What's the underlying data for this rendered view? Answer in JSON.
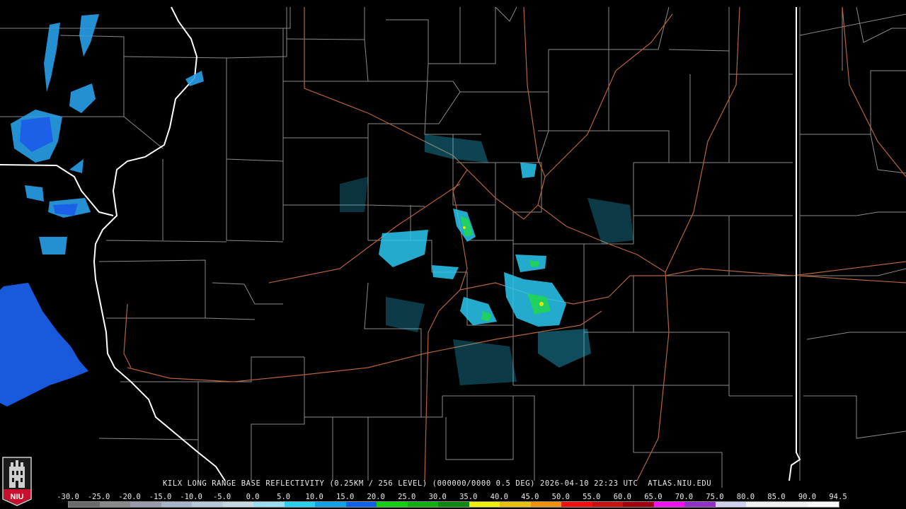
{
  "product": {
    "caption": "KILX LONG RANGE BASE REFLECTIVITY (0.25KM / 256 LEVEL) (000000/0000 0.5 DEG) 2026-04-10 22:23 UTC  ATLAS.NIU.EDU"
  },
  "legend": {
    "values": [
      "-30.0",
      "-25.0",
      "-20.0",
      "-15.0",
      "-10.0",
      "-5.0",
      "0.0",
      "5.0",
      "10.0",
      "15.0",
      "20.0",
      "25.0",
      "30.0",
      "35.0",
      "40.0",
      "45.0",
      "50.0",
      "55.0",
      "60.0",
      "65.0",
      "70.0",
      "75.0",
      "80.0",
      "85.0",
      "90.0",
      "94.5"
    ],
    "colors": [
      "#6a6a6a",
      "#8a8a8a",
      "#9a9aaa",
      "#aab4c8",
      "#b8c8d8",
      "#c8d8e0",
      "#9adcf0",
      "#2ad0f0",
      "#10a0e8",
      "#1060e8",
      "#10d010",
      "#10b010",
      "#108810",
      "#f0f010",
      "#e8c010",
      "#f09010",
      "#f01010",
      "#c81010",
      "#a00010",
      "#f010f0",
      "#9030c8",
      "#d0d0f0",
      "#f0f0f0",
      "#f0f0f0",
      "#f8f8f8"
    ]
  },
  "logo": {
    "text": "NIU"
  },
  "colors": {
    "state_border": "#ffffff",
    "county_border": "#8a8a8a",
    "highway": "#b5643a",
    "echo_weak": "#2aa0e8",
    "echo_mid": "#20d060"
  }
}
